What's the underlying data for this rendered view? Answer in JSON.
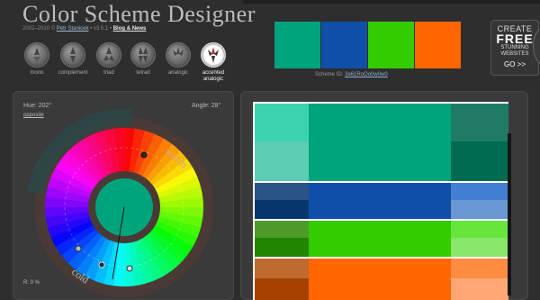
{
  "app": {
    "title": "Color Scheme Designer",
    "subline_prefix": "2002–2010 © ",
    "author": "Petr Stanicek",
    "version": " • v3.5.1 • ",
    "blog_link": "Blog & News"
  },
  "modes": [
    {
      "label": "mono",
      "icon": "mono-icon",
      "active": false
    },
    {
      "label": "complement",
      "icon": "complement-icon",
      "active": false
    },
    {
      "label": "triad",
      "icon": "triad-icon",
      "active": false
    },
    {
      "label": "tetrad",
      "icon": "tetrad-icon",
      "active": false
    },
    {
      "label": "analogic",
      "icon": "analogic-icon",
      "active": false
    },
    {
      "label": "accented analogic",
      "icon": "accented-analogic-icon",
      "active": true
    }
  ],
  "swatches": [
    "#00a47c",
    "#0f4fa8",
    "#33cc00",
    "#ff6600"
  ],
  "scheme": {
    "label": "Scheme ID: ",
    "id": "3a61RoOo0w0w0"
  },
  "ad": {
    "line1": "CREATE",
    "line2": "FREE",
    "line3a": "STUNNING",
    "line3b": "WEBSITES",
    "cta": "GO >>"
  },
  "wheel": {
    "hue_label": "Hue: 202°",
    "angle_label": "Angle: 28°",
    "opposite_link": "opposite",
    "warm_label": "warm",
    "cold_label": "cold",
    "rgb_label": "R:   0 %",
    "center_color": "#00a47c"
  },
  "preview_rows": [
    {
      "name": "green",
      "left": [
        "#3bd3b0",
        "#5ccdb3"
      ],
      "main": "#00a47c",
      "right": [
        "#1f7b65",
        "#006b51"
      ]
    },
    {
      "name": "blue",
      "left": [
        "#2a5386",
        "#05366d"
      ],
      "main": "#0f4fa8",
      "right": [
        "#4380d3",
        "#6997d3"
      ]
    },
    {
      "name": "lime",
      "left": [
        "#4e9a2b",
        "#218500"
      ],
      "main": "#33cc00",
      "right": [
        "#66e53d",
        "#88e66b"
      ]
    },
    {
      "name": "orange",
      "left": [
        "#bf6a30",
        "#a64200"
      ],
      "main": "#ff6600",
      "right": [
        "#ff8c40",
        "#ffa873"
      ]
    }
  ]
}
